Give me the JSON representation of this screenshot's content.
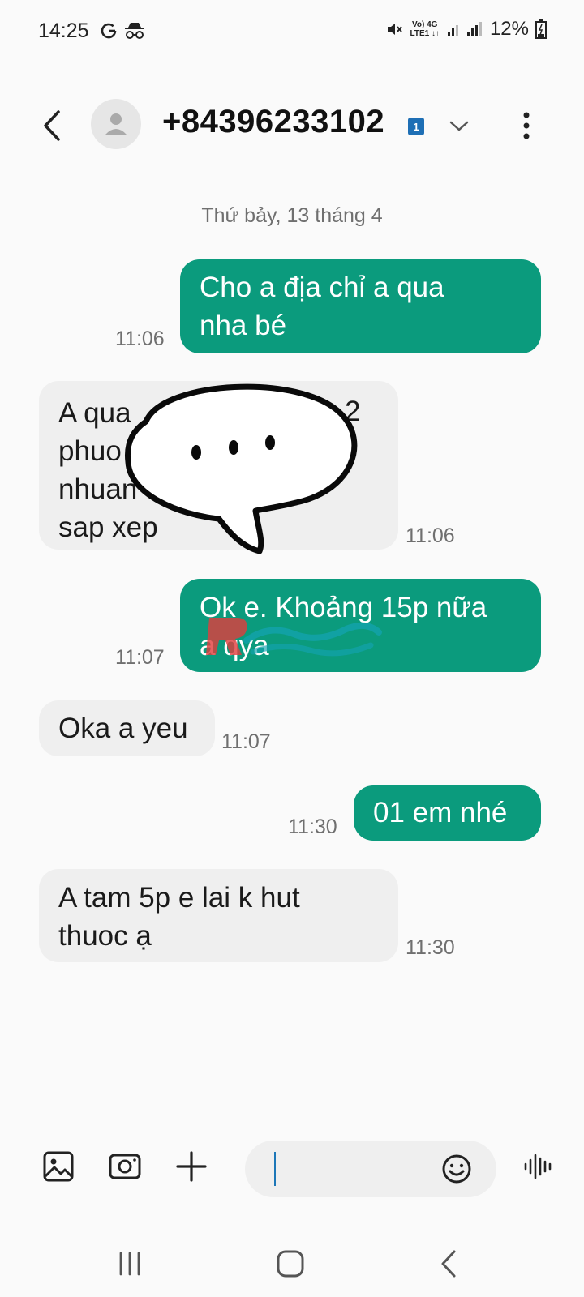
{
  "status_bar": {
    "time": "14:25",
    "battery": "12%",
    "network_top": "Vo) 4G",
    "network_bottom": "LTE1 ↓↑",
    "icons": [
      "google-g-icon",
      "incognito-icon",
      "mute-icon",
      "signal-icon",
      "battery-icon"
    ]
  },
  "header": {
    "contact": "+84396233102",
    "sim_badge": "1",
    "icons": [
      "back-arrow-icon",
      "avatar-person-icon",
      "chevron-down-icon",
      "more-vertical-icon"
    ]
  },
  "conversation": {
    "date": "Thứ bảy, 13 tháng 4",
    "messages": [
      {
        "direction": "sent",
        "text": "Cho a địa chỉ a qua\nnha bé",
        "time": "11:06"
      },
      {
        "direction": "received",
        "text": "A qua \nphuo\nnhuan\nsap xep",
        "time": "11:06"
      },
      {
        "direction": "sent",
        "text": "Ok e. Khoảng 15p nữa\na qya",
        "time": "11:07"
      },
      {
        "direction": "received",
        "text": "Oka a yeu",
        "time": "11:07"
      },
      {
        "direction": "sent",
        "text": "01 em nhé",
        "time": "11:30"
      },
      {
        "direction": "received",
        "text": "A tam 5p e lai k hut\nthuoc ạ",
        "time": "11:30"
      }
    ],
    "redacted_fragment": "2"
  },
  "watermark": "Rohang",
  "input_bar": {
    "icons": [
      "gallery-icon",
      "camera-icon",
      "plus-icon",
      "emoji-icon",
      "voice-icon"
    ]
  },
  "nav_bar": {
    "icons": [
      "recent-apps-icon",
      "home-icon",
      "back-icon"
    ]
  },
  "colors": {
    "sent_bubble": "#0b9b7d",
    "received_bubble": "#efefef",
    "background": "#fafafa",
    "sim_badge": "#1e6fb5"
  }
}
